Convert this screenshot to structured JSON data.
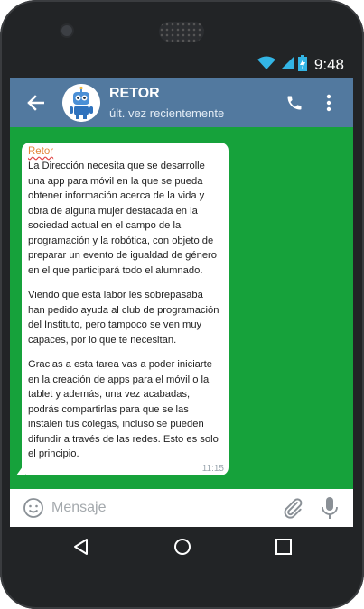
{
  "status_bar": {
    "time": "9:48",
    "icons": [
      "wifi-icon",
      "signal-icon",
      "battery-charging-icon"
    ]
  },
  "header": {
    "title": "RETOR",
    "subtitle": "últ. vez recientemente",
    "icons": [
      "back-arrow-icon",
      "robot-avatar",
      "phone-icon",
      "more-vert-icon"
    ]
  },
  "message": {
    "sender": "Retor",
    "paragraphs": [
      "La Dirección necesita que se desarrolle una app para móvil en la que se pueda obtener información acerca de la vida y obra de alguna mujer destacada en la sociedad actual en el campo de la programación y la robótica, con objeto de preparar un evento de igualdad de género en el que participará todo el alumnado.",
      "Viendo que esta labor les sobrepasaba han pedido ayuda al club de programación del Instituto, pero tampoco se ven muy capaces, por lo que te necesitan.",
      "Gracias a esta tarea vas a poder iniciarte en la creación de apps para el móvil o la tablet y además, una vez acabadas, podrás compartirlas para que se las instalen tus colegas, incluso se pueden difundir a través de las redes. Esto es solo el principio."
    ],
    "time": "11:15"
  },
  "input": {
    "placeholder": "Mensaje",
    "value": "",
    "icons": [
      "emoji-icon",
      "paperclip-icon",
      "microphone-icon"
    ]
  },
  "nav_bar": {
    "icons": [
      "nav-back-icon",
      "nav-home-icon",
      "nav-recents-icon"
    ]
  },
  "colors": {
    "app_bar": "#52799f",
    "chat_background": "#16a23b",
    "sender_name": "#e4873b",
    "phone_body": "#222426"
  }
}
